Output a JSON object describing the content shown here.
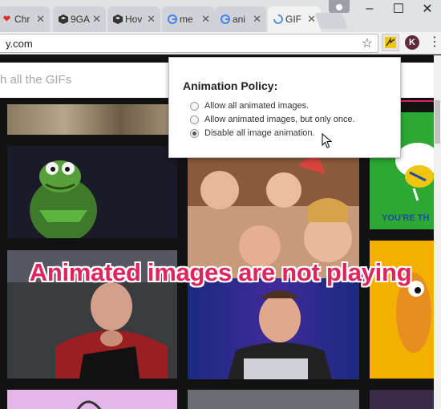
{
  "tabs": [
    {
      "title": "Chr",
      "icon": "heart-icon",
      "favicon_color": "#d93025"
    },
    {
      "title": "9GA",
      "icon": "shield-logo-icon",
      "favicon_color": "#333333"
    },
    {
      "title": "Hov",
      "icon": "shield-logo-icon",
      "favicon_color": "#333333"
    },
    {
      "title": "me",
      "icon": "google-icon",
      "favicon_color": "#4285f4"
    },
    {
      "title": "ani",
      "icon": "google-icon",
      "favicon_color": "#4285f4"
    },
    {
      "title": "GIF",
      "icon": "loading-spinner-icon",
      "favicon_color": "#4285f4"
    }
  ],
  "window_controls": {
    "minimize": "–",
    "maximize": "☐",
    "close": "✕"
  },
  "omnibox": {
    "url": "y.com"
  },
  "toolbar": {
    "avatar_letter": "K"
  },
  "page": {
    "search_placeholder": "h all the GIFs"
  },
  "popup": {
    "title": "Animation Policy:",
    "options": [
      {
        "label": "Allow all animated images.",
        "selected": false
      },
      {
        "label": "Allow animated images, but only once.",
        "selected": false
      },
      {
        "label": "Disable all image animation.",
        "selected": true
      }
    ]
  },
  "overlay_caption": "Animated images are not playing",
  "tile_text": {
    "youre_the": "YOU'RE TH"
  },
  "colors": {
    "caption": "#e0245e",
    "green_tile": "#2ca833",
    "page_bg": "#121212"
  }
}
